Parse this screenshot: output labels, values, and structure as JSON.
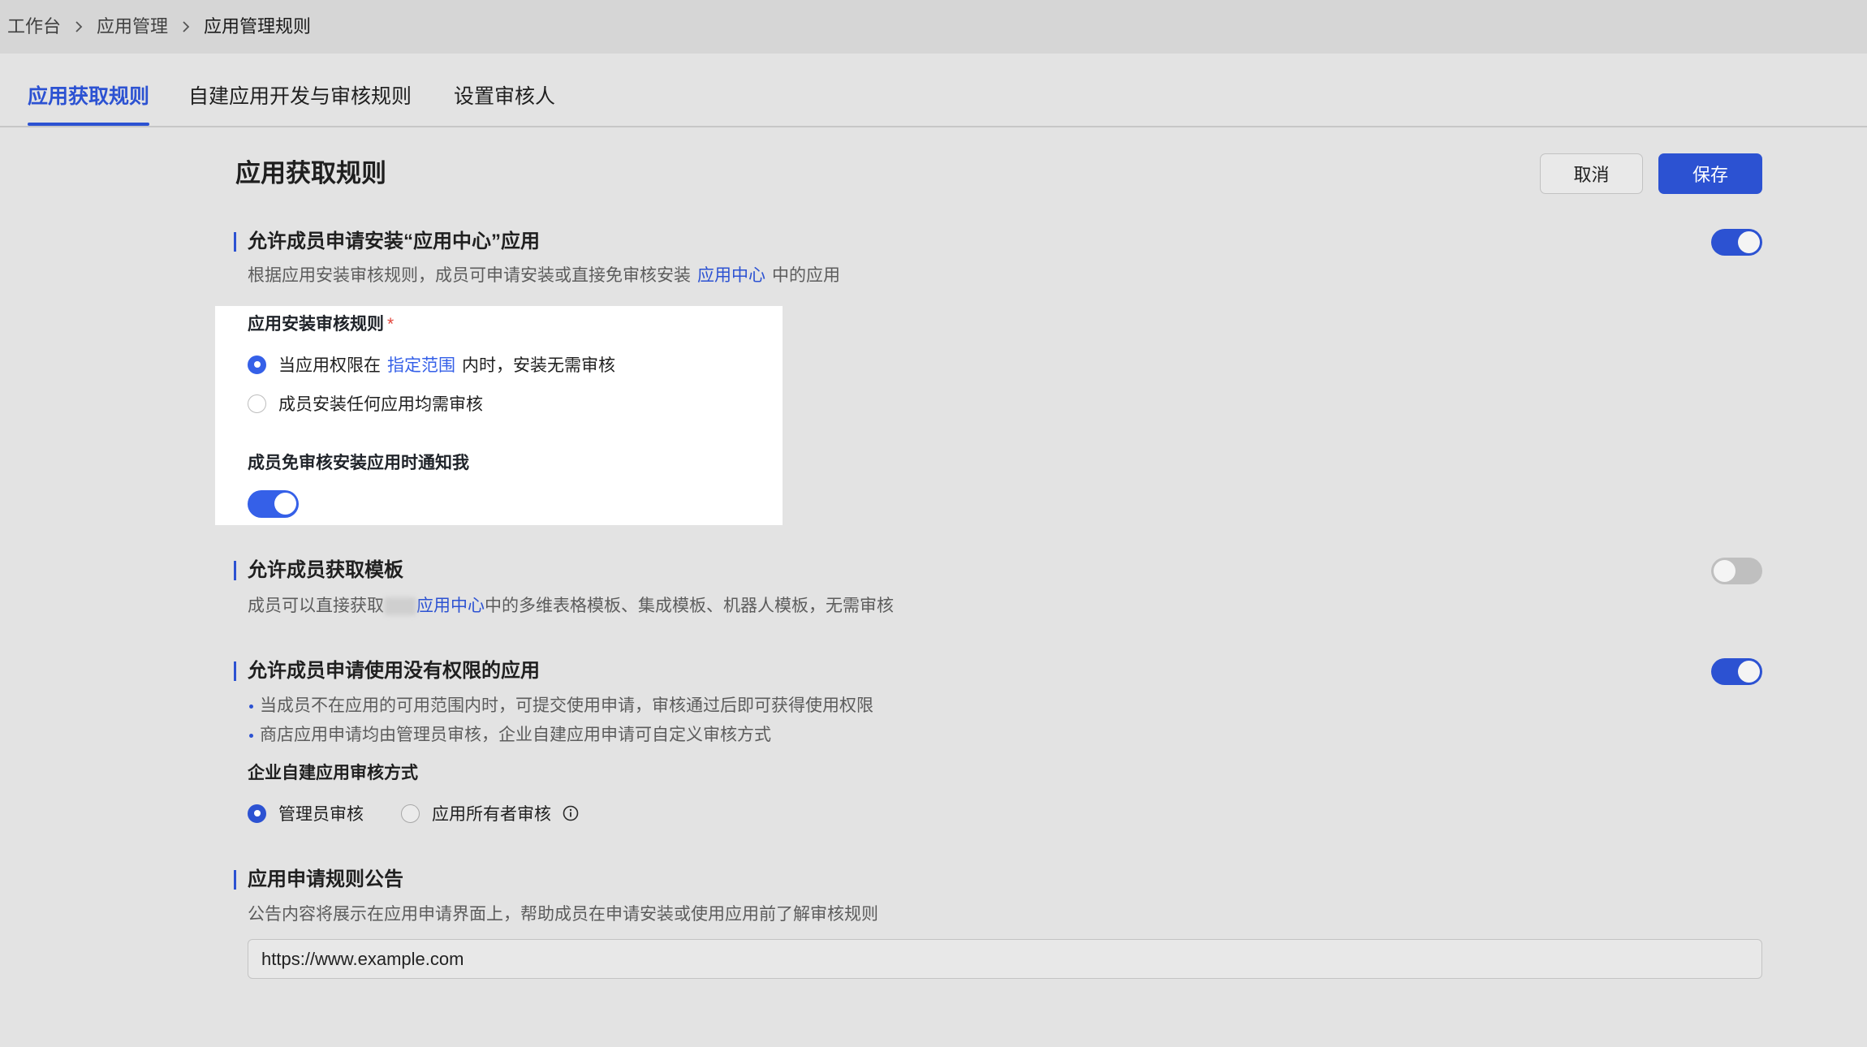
{
  "colors": {
    "accent": "#2c52d2",
    "accent_bright": "#3560e8",
    "required": "#e2463c",
    "toggle_off": "#bfbfbf"
  },
  "breadcrumb": {
    "items": [
      "工作台",
      "应用管理",
      "应用管理规则"
    ]
  },
  "tabs": [
    {
      "label": "应用获取规则",
      "active": true
    },
    {
      "label": "自建应用开发与审核规则",
      "active": false
    },
    {
      "label": "设置审核人",
      "active": false
    }
  ],
  "header": {
    "title": "应用获取规则",
    "cancel_label": "取消",
    "save_label": "保存"
  },
  "install_section": {
    "title": "允许成员申请安装“应用中心”应用",
    "enabled": true,
    "desc_before": "根据应用安装审核规则，成员可申请安装或直接免审核安装",
    "desc_link": "应用中心",
    "desc_after": "中的应用",
    "rule_label": "应用安装审核规则",
    "required_mark": "*",
    "option_scoped": {
      "before": "当应用权限在",
      "link": "指定范围",
      "after": "内时，安装无需审核",
      "selected": true
    },
    "option_all": {
      "label": "成员安装任何应用均需审核",
      "selected": false
    },
    "notify_label": "成员免审核安装应用时通知我",
    "notify_enabled": true
  },
  "template_section": {
    "title": "允许成员获取模板",
    "enabled": false,
    "desc_before": "成员可以直接获取",
    "desc_link": "应用中心",
    "desc_after": "中的多维表格模板、集成模板、机器人模板，无需审核"
  },
  "request_section": {
    "title": "允许成员申请使用没有权限的应用",
    "enabled": true,
    "bullets": [
      "当成员不在应用的可用范围内时，可提交使用申请，审核通过后即可获得使用权限",
      "商店应用申请均由管理员审核，企业自建应用申请可自定义审核方式"
    ],
    "review_label": "企业自建应用审核方式",
    "options": [
      {
        "label": "管理员审核",
        "selected": true
      },
      {
        "label": "应用所有者审核",
        "selected": false
      }
    ]
  },
  "notice_section": {
    "title": "应用申请规则公告",
    "desc": "公告内容将展示在应用申请界面上，帮助成员在申请安装或使用应用前了解审核规则",
    "input_value": "https://www.example.com"
  }
}
